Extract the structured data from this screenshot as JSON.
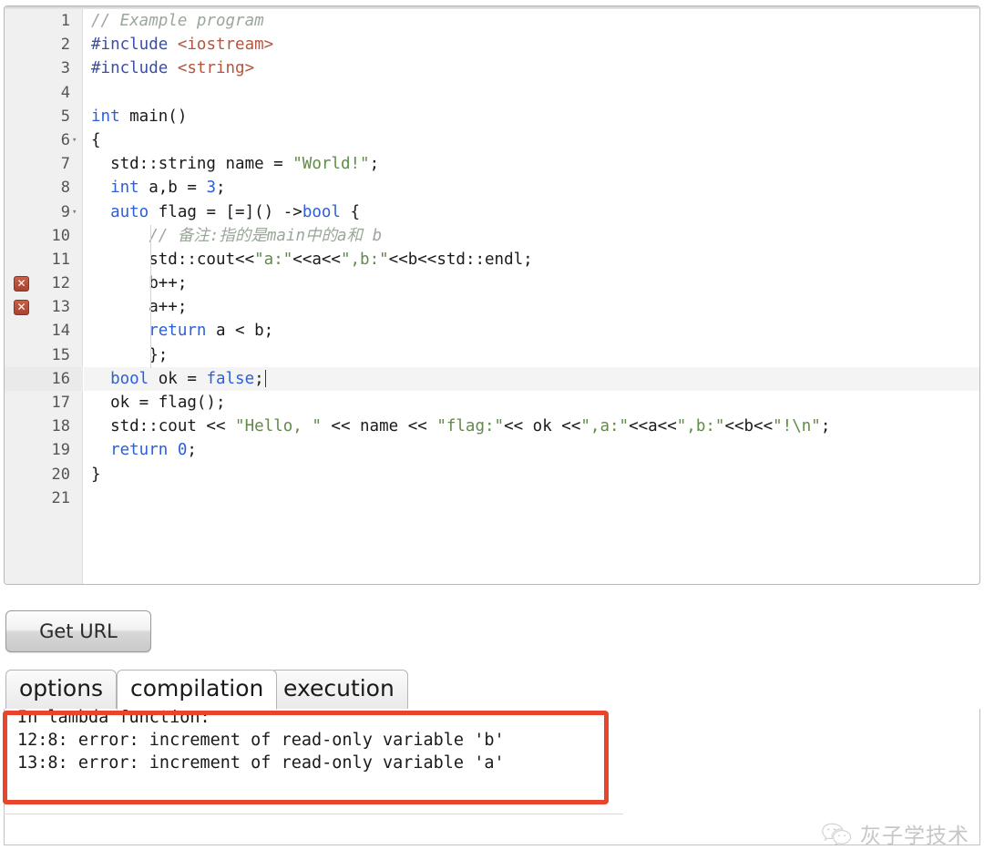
{
  "editor": {
    "lines": [
      {
        "n": 1,
        "fold": "",
        "error": false,
        "active": false,
        "indent": 0,
        "tokens": [
          {
            "t": "// Example program",
            "c": "cmt"
          }
        ]
      },
      {
        "n": 2,
        "fold": "",
        "error": false,
        "active": false,
        "indent": 0,
        "tokens": [
          {
            "t": "#include",
            "c": "pre"
          },
          {
            "t": " ",
            "c": "pl"
          },
          {
            "t": "<iostream>",
            "c": "hdr"
          }
        ]
      },
      {
        "n": 3,
        "fold": "",
        "error": false,
        "active": false,
        "indent": 0,
        "tokens": [
          {
            "t": "#include",
            "c": "pre"
          },
          {
            "t": " ",
            "c": "pl"
          },
          {
            "t": "<string>",
            "c": "hdr"
          }
        ]
      },
      {
        "n": 4,
        "fold": "",
        "error": false,
        "active": false,
        "indent": 0,
        "tokens": []
      },
      {
        "n": 5,
        "fold": "",
        "error": false,
        "active": false,
        "indent": 0,
        "tokens": [
          {
            "t": "int",
            "c": "kw"
          },
          {
            "t": " main()",
            "c": "pl"
          }
        ]
      },
      {
        "n": 6,
        "fold": "▾",
        "error": false,
        "active": false,
        "indent": 0,
        "tokens": [
          {
            "t": "{",
            "c": "pl"
          }
        ]
      },
      {
        "n": 7,
        "fold": "",
        "error": false,
        "active": false,
        "indent": 1,
        "tokens": [
          {
            "t": "  std::string name = ",
            "c": "pl"
          },
          {
            "t": "\"World!\"",
            "c": "str"
          },
          {
            "t": ";",
            "c": "pl"
          }
        ]
      },
      {
        "n": 8,
        "fold": "",
        "error": false,
        "active": false,
        "indent": 1,
        "tokens": [
          {
            "t": "  ",
            "c": "pl"
          },
          {
            "t": "int",
            "c": "kw"
          },
          {
            "t": " a,b = ",
            "c": "pl"
          },
          {
            "t": "3",
            "c": "num"
          },
          {
            "t": ";",
            "c": "pl"
          }
        ]
      },
      {
        "n": 9,
        "fold": "▾",
        "error": false,
        "active": false,
        "indent": 1,
        "tokens": [
          {
            "t": "  ",
            "c": "pl"
          },
          {
            "t": "auto",
            "c": "kw"
          },
          {
            "t": " flag = [=]() ->",
            "c": "pl"
          },
          {
            "t": "bool",
            "c": "kw"
          },
          {
            "t": " {",
            "c": "pl"
          }
        ]
      },
      {
        "n": 10,
        "fold": "",
        "error": false,
        "active": false,
        "indent": 2,
        "tokens": [
          {
            "t": "      // 备注:指的是main中的a和 b",
            "c": "cmt"
          }
        ]
      },
      {
        "n": 11,
        "fold": "",
        "error": false,
        "active": false,
        "indent": 2,
        "tokens": [
          {
            "t": "      std::cout<<",
            "c": "pl"
          },
          {
            "t": "\"a:\"",
            "c": "str"
          },
          {
            "t": "<<a<<",
            "c": "pl"
          },
          {
            "t": "\",b:\"",
            "c": "str"
          },
          {
            "t": "<<b<<std::endl;",
            "c": "pl"
          }
        ]
      },
      {
        "n": 12,
        "fold": "",
        "error": true,
        "active": false,
        "indent": 2,
        "tokens": [
          {
            "t": "      b++;",
            "c": "pl"
          }
        ]
      },
      {
        "n": 13,
        "fold": "",
        "error": true,
        "active": false,
        "indent": 2,
        "tokens": [
          {
            "t": "      a++;",
            "c": "pl"
          }
        ]
      },
      {
        "n": 14,
        "fold": "",
        "error": false,
        "active": false,
        "indent": 2,
        "tokens": [
          {
            "t": "      ",
            "c": "pl"
          },
          {
            "t": "return",
            "c": "kw"
          },
          {
            "t": " a < b;",
            "c": "pl"
          }
        ]
      },
      {
        "n": 15,
        "fold": "",
        "error": false,
        "active": false,
        "indent": 2,
        "tokens": [
          {
            "t": "      };",
            "c": "pl"
          }
        ]
      },
      {
        "n": 16,
        "fold": "",
        "error": false,
        "active": true,
        "indent": 1,
        "tokens": [
          {
            "t": "  ",
            "c": "pl"
          },
          {
            "t": "bool",
            "c": "kw"
          },
          {
            "t": " ok = ",
            "c": "pl"
          },
          {
            "t": "false",
            "c": "kw"
          },
          {
            "t": ";",
            "c": "pl"
          }
        ]
      },
      {
        "n": 17,
        "fold": "",
        "error": false,
        "active": false,
        "indent": 1,
        "tokens": [
          {
            "t": "  ok = flag();",
            "c": "pl"
          }
        ]
      },
      {
        "n": 18,
        "fold": "",
        "error": false,
        "active": false,
        "indent": 1,
        "tokens": [
          {
            "t": "  std::cout << ",
            "c": "pl"
          },
          {
            "t": "\"Hello, \"",
            "c": "str"
          },
          {
            "t": " << name << ",
            "c": "pl"
          },
          {
            "t": "\"flag:\"",
            "c": "str"
          },
          {
            "t": "<< ok <<",
            "c": "pl"
          },
          {
            "t": "\",a:\"",
            "c": "str"
          },
          {
            "t": "<<a<<",
            "c": "pl"
          },
          {
            "t": "\",b:\"",
            "c": "str"
          },
          {
            "t": "<<b<<",
            "c": "pl"
          },
          {
            "t": "\"!\\n\"",
            "c": "str"
          },
          {
            "t": ";",
            "c": "pl"
          }
        ]
      },
      {
        "n": 19,
        "fold": "",
        "error": false,
        "active": false,
        "indent": 1,
        "tokens": [
          {
            "t": "  ",
            "c": "pl"
          },
          {
            "t": "return",
            "c": "kw"
          },
          {
            "t": " ",
            "c": "pl"
          },
          {
            "t": "0",
            "c": "num"
          },
          {
            "t": ";",
            "c": "pl"
          }
        ]
      },
      {
        "n": 20,
        "fold": "",
        "error": false,
        "active": false,
        "indent": 0,
        "tokens": [
          {
            "t": "}",
            "c": "pl"
          }
        ]
      },
      {
        "n": 21,
        "fold": "",
        "error": false,
        "active": false,
        "indent": 0,
        "tokens": []
      }
    ],
    "error_marker_glyph": "✕"
  },
  "toolbar": {
    "get_url_label": "Get URL"
  },
  "tabs": [
    {
      "label": "options",
      "active": false
    },
    {
      "label": "compilation",
      "active": true
    },
    {
      "label": "execution",
      "active": false
    }
  ],
  "output": {
    "lines": [
      "In lambda function:",
      "12:8: error: increment of read-only variable 'b'",
      "13:8: error: increment of read-only variable 'a'"
    ]
  },
  "annotation": {
    "highlight_color": "#e8452a"
  },
  "watermark": {
    "text": "灰子学技术",
    "icon": "wechat-icon"
  }
}
